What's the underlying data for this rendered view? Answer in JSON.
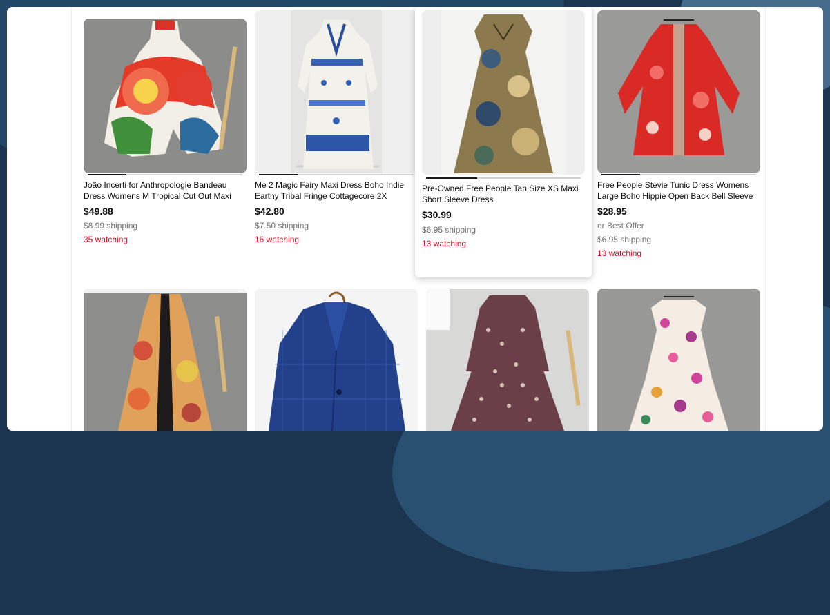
{
  "listings": [
    {
      "title_line1": "João Incerti for Anthropologie Bandeau",
      "title_line2": "Dress Womens M Tropical Cut Out Maxi",
      "price": "$49.88",
      "shipping": "$8.99 shipping",
      "watching": "35 watching"
    },
    {
      "title_line1": "Me 2 Magic Fairy Maxi Dress Boho Indie",
      "title_line2": "Earthy Tribal Fringe Cottagecore 2X",
      "price": "$42.80",
      "shipping": "$7.50 shipping",
      "watching": "16 watching"
    },
    {
      "title_line1": "Pre-Owned Free People Tan Size XS Maxi",
      "title_line2": "Short Sleeve Dress",
      "price": "$30.99",
      "shipping": "$6.95 shipping",
      "watching": "13 watching"
    },
    {
      "title_line1": "Free People Stevie Tunic Dress Womens",
      "title_line2": "Large Boho Hippie Open Back Bell Sleeve",
      "price": "$28.95",
      "offer": "or Best Offer",
      "shipping": "$6.95 shipping",
      "watching": "13 watching"
    }
  ],
  "images": [
    {
      "icon": "tropical-maxi-dress-photo"
    },
    {
      "icon": "blue-white-maxi-dress-photo"
    },
    {
      "icon": "tan-floral-maxi-dress-photo"
    },
    {
      "icon": "red-tunic-dress-photo"
    },
    {
      "icon": "paisley-maxi-dress-photo"
    },
    {
      "icon": "navy-plaid-blazer-photo"
    },
    {
      "icon": "print-midi-dress-photo"
    },
    {
      "icon": "pink-floral-dress-photo"
    }
  ],
  "colors": {
    "price_text": "#111111",
    "watching_text": "#e0102a",
    "shipping_text": "#707070",
    "background": "#1b3550"
  }
}
